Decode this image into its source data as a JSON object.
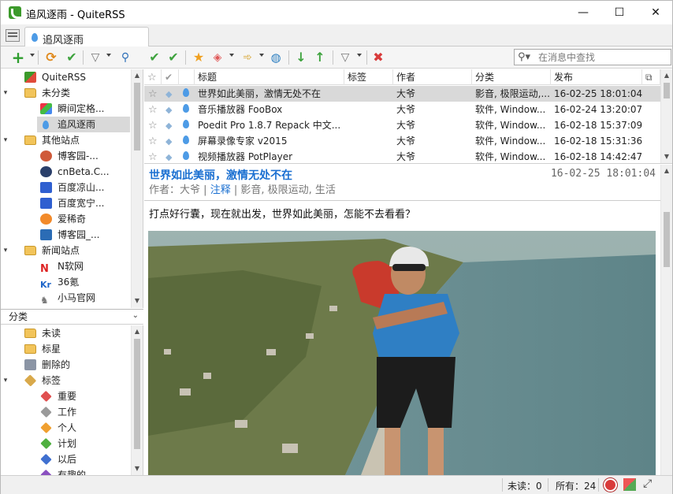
{
  "window": {
    "title": "追风逐雨 - QuiteRSS",
    "minimize_glyph": "—",
    "maximize_glyph": "☐",
    "close_glyph": "✕"
  },
  "tabs": [
    {
      "label": "追风逐雨",
      "icon": "water-drop-icon"
    }
  ],
  "search": {
    "placeholder": "在消息中查找"
  },
  "feeds": {
    "items": [
      {
        "label": "QuiteRSS",
        "icon": "quiterss-logo-icon",
        "level": 0,
        "arrow": ""
      },
      {
        "label": "未分类",
        "icon": "folder-icon",
        "level": 0,
        "arrow": "▾"
      },
      {
        "label": "瞬间定格...",
        "icon": "colorful-feed-icon",
        "level": 1,
        "arrow": ""
      },
      {
        "label": "追风逐雨",
        "icon": "water-drop-icon",
        "level": 1,
        "arrow": "",
        "selected": true
      },
      {
        "label": "其他站点",
        "icon": "folder-icon",
        "level": 0,
        "arrow": "▾"
      },
      {
        "label": "博客园-...",
        "icon": "cnblogs-icon",
        "level": 1,
        "arrow": ""
      },
      {
        "label": "cnBeta.C...",
        "icon": "cnbeta-icon",
        "level": 1,
        "arrow": ""
      },
      {
        "label": "百度凉山...",
        "icon": "baidu-paw-icon",
        "level": 1,
        "arrow": ""
      },
      {
        "label": "百度宽宁...",
        "icon": "baidu-paw-icon",
        "level": 1,
        "arrow": ""
      },
      {
        "label": "爱稀奇",
        "icon": "aixiqi-icon",
        "level": 1,
        "arrow": ""
      },
      {
        "label": "博客园_...",
        "icon": "cnblogs-square-icon",
        "level": 1,
        "arrow": ""
      },
      {
        "label": "新闻站点",
        "icon": "folder-icon",
        "level": 0,
        "arrow": "▾"
      },
      {
        "label": "N软网",
        "icon": "n-logo-icon",
        "level": 1,
        "arrow": ""
      },
      {
        "label": "36氪",
        "icon": "kr-logo-icon",
        "level": 1,
        "arrow": ""
      },
      {
        "label": "小马官网",
        "icon": "horse-icon",
        "level": 1,
        "arrow": ""
      }
    ]
  },
  "categories": {
    "header": "分类",
    "items": [
      {
        "label": "未读",
        "icon": "unread-folder-icon",
        "level": 0,
        "arrow": ""
      },
      {
        "label": "标星",
        "icon": "star-folder-icon",
        "level": 0,
        "arrow": ""
      },
      {
        "label": "删除的",
        "icon": "trash-icon",
        "level": 0,
        "arrow": ""
      },
      {
        "label": "标签",
        "icon": "tag-icon",
        "level": 0,
        "arrow": "▾"
      },
      {
        "label": "重要",
        "icon": "tag-red-icon",
        "level": 1,
        "arrow": "",
        "color": "#e05050"
      },
      {
        "label": "工作",
        "icon": "tag-gray-icon",
        "level": 1,
        "arrow": "",
        "color": "#9a9a9a"
      },
      {
        "label": "个人",
        "icon": "tag-orange-icon",
        "level": 1,
        "arrow": "",
        "color": "#f0a030"
      },
      {
        "label": "计划",
        "icon": "tag-green-icon",
        "level": 1,
        "arrow": "",
        "color": "#50b040"
      },
      {
        "label": "以后",
        "icon": "tag-blue-icon",
        "level": 1,
        "arrow": "",
        "color": "#4070d0"
      },
      {
        "label": "有趣的",
        "icon": "tag-purple-icon",
        "level": 1,
        "arrow": "",
        "color": "#8a50c0"
      }
    ]
  },
  "news": {
    "columns": [
      "标题",
      "标签",
      "作者",
      "分类",
      "发布"
    ],
    "rows": [
      {
        "title": "世界如此美丽，激情无处不在",
        "author": "大爷",
        "category": "影音, 极限运动,...",
        "date": "16-02-25 18:01:04",
        "selected": true
      },
      {
        "title": "音乐播放器 FooBox",
        "author": "大爷",
        "category": "软件, Window...",
        "date": "16-02-24 13:20:07"
      },
      {
        "title": "Poedit Pro 1.8.7 Repack 中文...",
        "author": "大爷",
        "category": "软件, Window...",
        "date": "16-02-18 15:37:09"
      },
      {
        "title": "屏幕录像专家 v2015",
        "author": "大爷",
        "category": "软件, Window...",
        "date": "16-02-18 15:31:36"
      },
      {
        "title": "视频播放器 PotPlayer",
        "author": "大爷",
        "category": "软件, Window...",
        "date": "16-02-18 14:42:47"
      }
    ]
  },
  "article": {
    "title": "世界如此美丽，激情无处不在",
    "date": "16-02-25 18:01:04",
    "author_label": "作者：",
    "author": "大爷",
    "comments_link": "注释",
    "categories": "影音, 极限运动, 生活",
    "body": "打点好行囊，现在就出发，世界如此美丽，怎能不去看看？"
  },
  "status": {
    "unread_label": "未读：",
    "unread": "0",
    "all_label": "所有：",
    "all": "24"
  },
  "colors": {
    "accent_link": "#1a6fd1",
    "selection": "#d9d9d9"
  }
}
